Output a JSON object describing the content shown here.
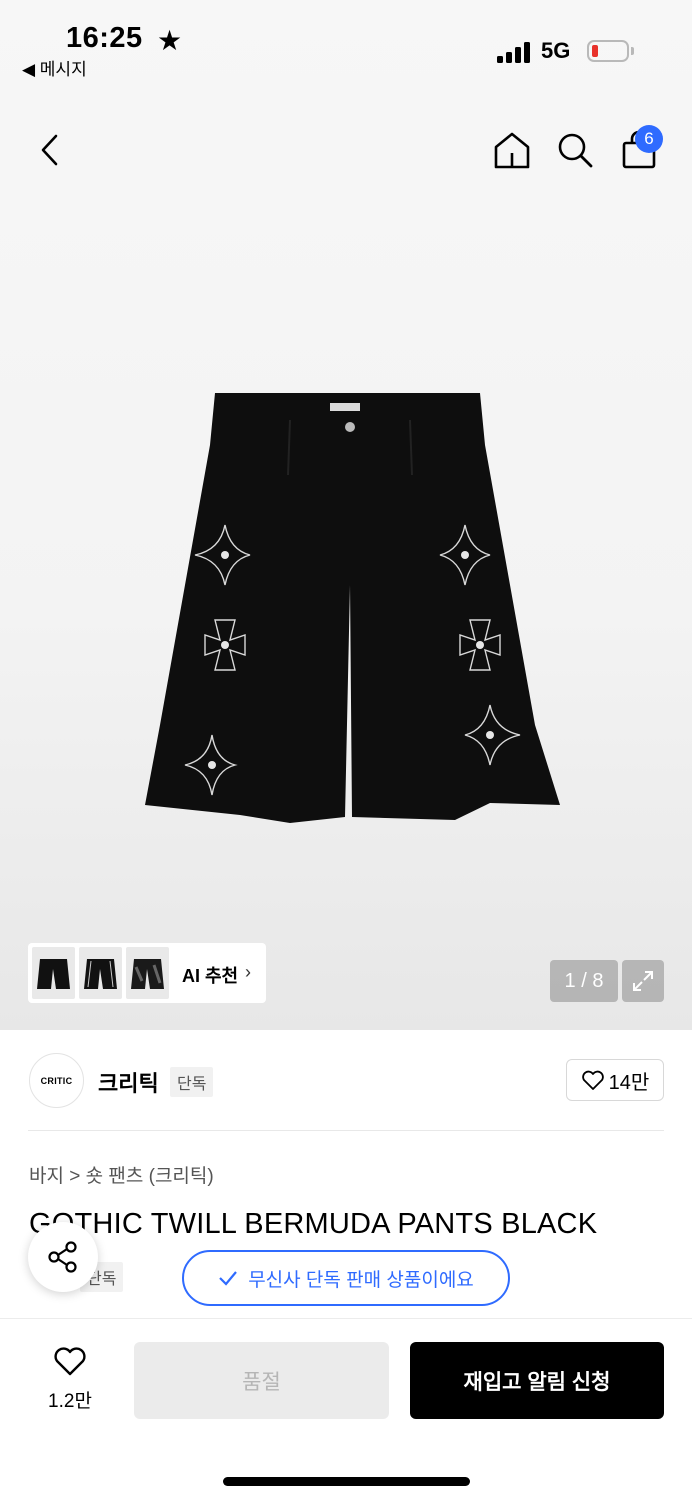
{
  "status_bar": {
    "time": "16:25",
    "back_app": "◀ 메시지",
    "network": "5G",
    "battery_color": "#e8322b"
  },
  "nav": {
    "back_icon": "chevron-left-icon",
    "cart_badge": "6"
  },
  "gallery": {
    "ai_label": "AI 추천",
    "counter": "1 / 8",
    "thumbnail_count": 3
  },
  "brand": {
    "logo_text": "CRITIC",
    "name": "크리틱",
    "tag": "단독",
    "like_count": "14만"
  },
  "product": {
    "breadcrumb": "바지 > 숏 팬츠 (크리틱)",
    "title": "GOTHIC TWILL BERMUDA PANTS BLACK",
    "tag": "단독",
    "exclusive_notice": "무신사 단독 판매 상품이에요"
  },
  "bottom": {
    "wish_count": "1.2만",
    "soldout_label": "품절",
    "restock_label": "재입고 알림 신청"
  },
  "colors": {
    "accent": "#2f6bff",
    "primary_button": "#000000",
    "disabled_button": "#ebebeb"
  }
}
